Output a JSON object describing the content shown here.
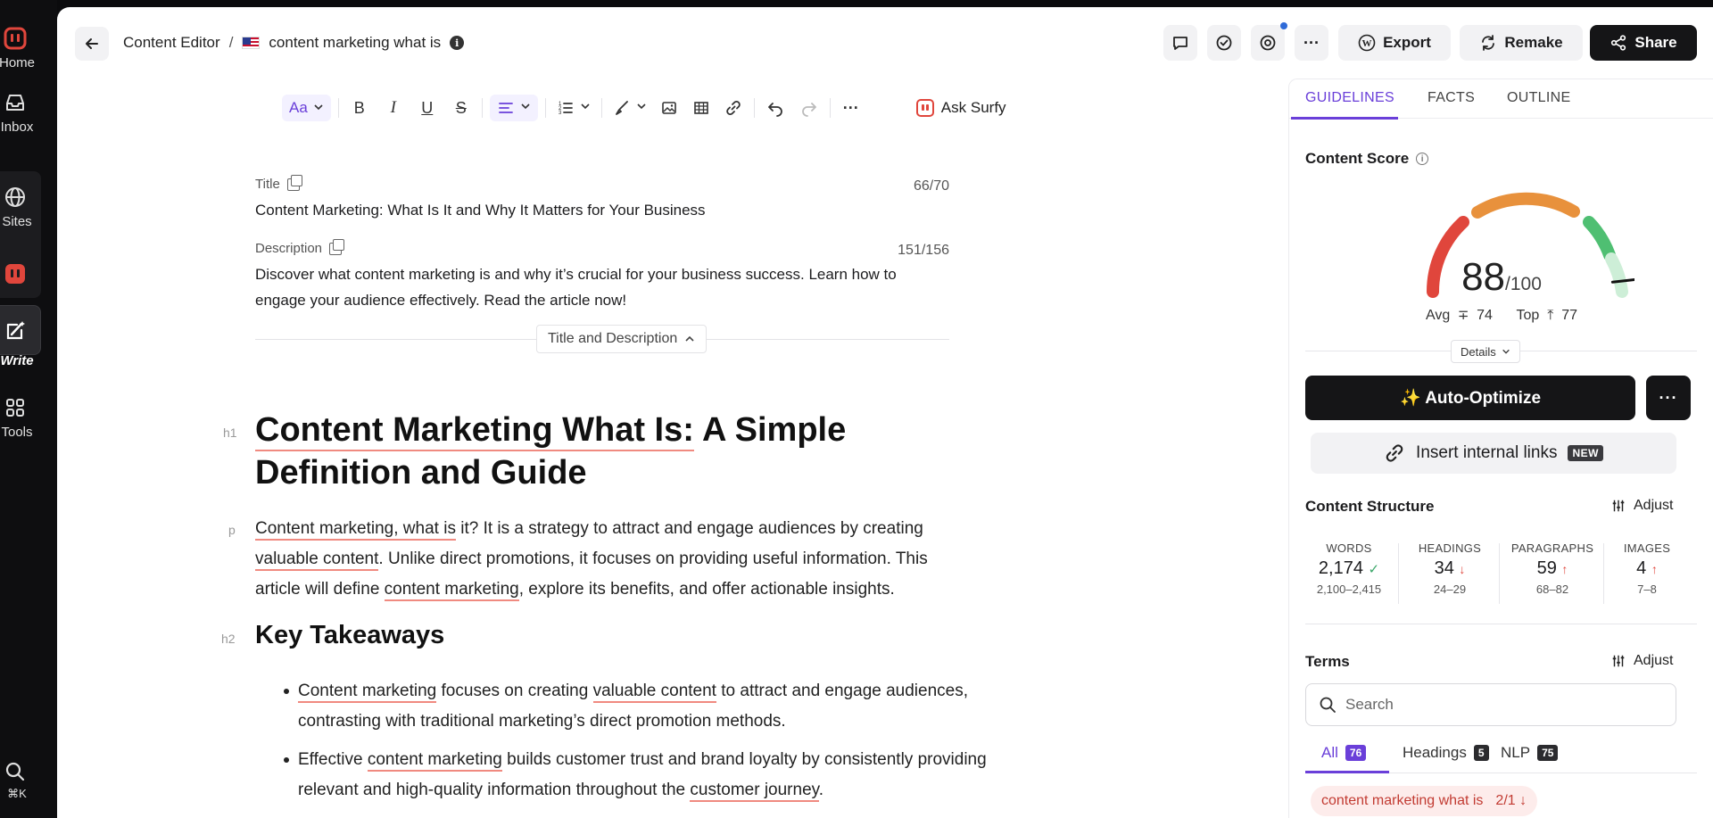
{
  "rail": {
    "items": [
      {
        "label": "Home"
      },
      {
        "label": "Inbox"
      },
      {
        "label": "Sites"
      },
      {
        "label": "Write"
      },
      {
        "label": "Tools"
      }
    ],
    "shortcut": "⌘K"
  },
  "header": {
    "breadcrumb_root": "Content Editor",
    "separator": "/",
    "doc_title": "content marketing what is",
    "export_label": "Export",
    "remake_label": "Remake",
    "share_label": "Share"
  },
  "toolbar": {
    "font_label": "Aa",
    "ask_label": "Ask Surfy"
  },
  "meta": {
    "title_label": "Title",
    "title_count": "66/70",
    "title_text": "Content Marketing: What Is It and Why It Matters for Your Business",
    "description_label": "Description",
    "description_count": "151/156",
    "description_text": "Discover what content marketing is and why it’s crucial for your business success. Learn how to engage your audience effectively. Read the article now!",
    "toggle_label": "Title and Description"
  },
  "article": {
    "h1_tag": "h1",
    "h1_part1": "Content Marketing What Is:",
    "h1_part2": " A Simple Definition and Guide",
    "p_tag": "p",
    "p_s1": "Content marketing, what is",
    "p_s2": " it? It is a strategy to attract and engage audiences by creating ",
    "p_s3": "valuable content",
    "p_s4": ". Unlike direct promotions, it focuses on providing useful information. This article will define ",
    "p_s5": "content marketing",
    "p_s6": ", explore its benefits, and offer actionable insights.",
    "h2_tag": "h2",
    "h2_text": "Key Takeaways",
    "b1_s1": "Content marketing",
    "b1_s2": " focuses on creating ",
    "b1_s3": "valuable content",
    "b1_s4": " to attract and engage audiences, contrasting with traditional marketing’s direct promotion methods.",
    "b2_s1": "Effective ",
    "b2_s2": "content marketing",
    "b2_s3": " builds customer trust and brand loyalty by consistently providing relevant and high-quality information throughout the ",
    "b2_s4": "customer journey",
    "b2_s5": "."
  },
  "panel": {
    "tabs": [
      "GUIDELINES",
      "FACTS",
      "OUTLINE"
    ],
    "score_title": "Content Score",
    "score_value": "88",
    "score_max": "/100",
    "score_fraction": 0.88,
    "avg_label": "Avg",
    "avg_value": "74",
    "top_label": "Top",
    "top_value": "77",
    "details_label": "Details",
    "auto_optimize_label": "✨ Auto-Optimize",
    "internal_links_label": "Insert internal links",
    "new_badge": "NEW",
    "structure_title": "Content Structure",
    "adjust_label": "Adjust",
    "stats": [
      {
        "key": "WORDS",
        "value": "2,174",
        "range": "2,100–2,415"
      },
      {
        "key": "HEADINGS",
        "value": "34",
        "range": "24–29"
      },
      {
        "key": "PARAGRAPHS",
        "value": "59",
        "range": "68–82"
      },
      {
        "key": "IMAGES",
        "value": "4",
        "range": "7–8"
      }
    ],
    "terms_title": "Terms",
    "search_placeholder": "Search",
    "filter_tabs": [
      {
        "label": "All",
        "count": "76"
      },
      {
        "label": "Headings",
        "count": "5"
      },
      {
        "label": "NLP",
        "count": "75"
      }
    ],
    "term_chip": {
      "text": "content marketing what is",
      "count": "2/1"
    }
  },
  "colors": {
    "accent": "#6a3fd9",
    "gauge_red": "#e0463c",
    "gauge_orange": "#e8913c",
    "gauge_green": "#4fbf72",
    "underline": "#f08a80"
  }
}
